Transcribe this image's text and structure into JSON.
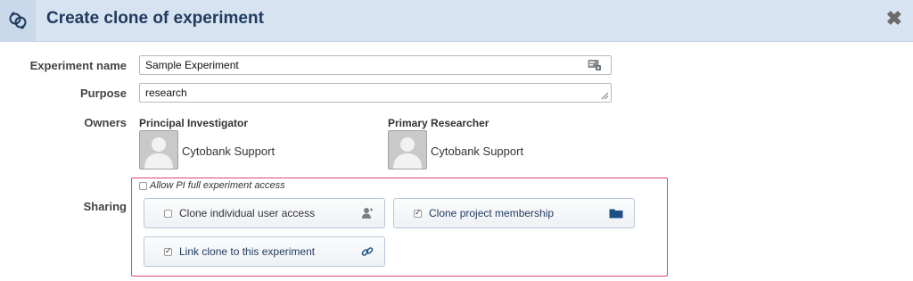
{
  "dialog": {
    "title": "Create clone of experiment",
    "close_label": "✖"
  },
  "form": {
    "experiment_name": {
      "label": "Experiment name",
      "value": "Sample Experiment"
    },
    "purpose": {
      "label": "Purpose",
      "value": "research"
    },
    "owners": {
      "label": "Owners",
      "principal_investigator": {
        "title": "Principal Investigator",
        "name": "Cytobank Support"
      },
      "primary_researcher": {
        "title": "Primary Researcher",
        "name": "Cytobank Support"
      }
    },
    "sharing": {
      "label": "Sharing",
      "allow_pi": {
        "label": "Allow PI full experiment access",
        "checked": false
      },
      "options": [
        {
          "label": "Clone individual user access",
          "checked": false,
          "icon": "user-icon"
        },
        {
          "label": "Clone project membership",
          "checked": true,
          "icon": "folder-icon"
        },
        {
          "label": "Link clone to this experiment",
          "checked": true,
          "icon": "link-icon"
        }
      ]
    }
  },
  "colors": {
    "header_bg": "#d7e3f1",
    "title": "#1f3a5e",
    "highlight_border": "#e0437a"
  }
}
